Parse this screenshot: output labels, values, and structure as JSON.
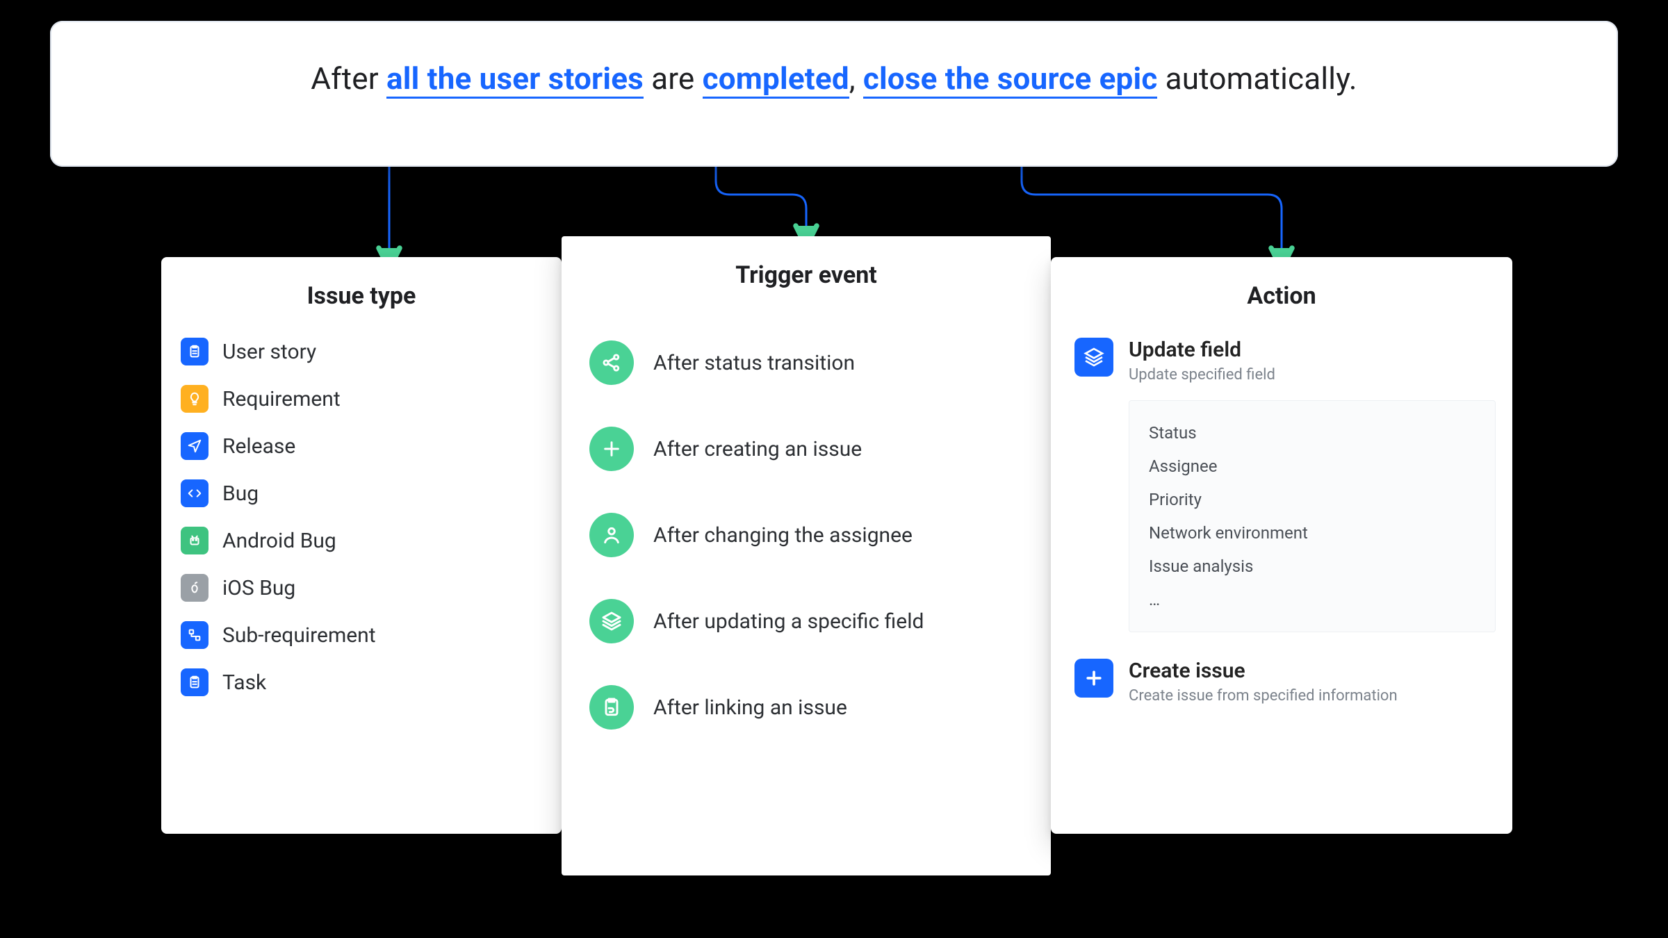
{
  "sentence": {
    "p1": "After ",
    "hl1": "all the user stories",
    "p2": " are ",
    "hl2": "completed",
    "comma": ", ",
    "hl3": "close the source epic",
    "p3": " automatically."
  },
  "issue": {
    "title": "Issue type",
    "items": [
      {
        "icon": "clipboard-icon",
        "color": "blue",
        "label": "User story"
      },
      {
        "icon": "lightbulb-icon",
        "color": "orange",
        "label": "Requirement"
      },
      {
        "icon": "send-icon",
        "color": "blue",
        "label": "Release"
      },
      {
        "icon": "code-icon",
        "color": "blue",
        "label": "Bug"
      },
      {
        "icon": "android-icon",
        "color": "green",
        "label": "Android Bug"
      },
      {
        "icon": "apple-icon",
        "color": "grey",
        "label": "iOS Bug"
      },
      {
        "icon": "subtree-icon",
        "color": "blue",
        "label": "Sub-requirement"
      },
      {
        "icon": "clipboard-icon",
        "color": "blue",
        "label": "Task"
      }
    ]
  },
  "trigger": {
    "title": "Trigger event",
    "items": [
      {
        "icon": "share-icon",
        "label": "After status transition"
      },
      {
        "icon": "plus-icon",
        "label": "After creating an issue"
      },
      {
        "icon": "user-icon",
        "label": "After changing the assignee"
      },
      {
        "icon": "layers-icon",
        "label": "After updating a specific field"
      },
      {
        "icon": "clipboard-link-icon",
        "label": "After linking an issue"
      }
    ]
  },
  "action": {
    "title": "Action",
    "update": {
      "icon": "layers-icon",
      "title": "Update field",
      "sub": "Update specified field",
      "fields": [
        "Status",
        "Assignee",
        "Priority",
        "Network environment",
        "Issue analysis",
        "…"
      ]
    },
    "create": {
      "icon": "plus-square-icon",
      "title": "Create issue",
      "sub": "Create issue from specified information"
    }
  },
  "colors": {
    "blue": "#1766ff",
    "green": "#4ad295"
  }
}
